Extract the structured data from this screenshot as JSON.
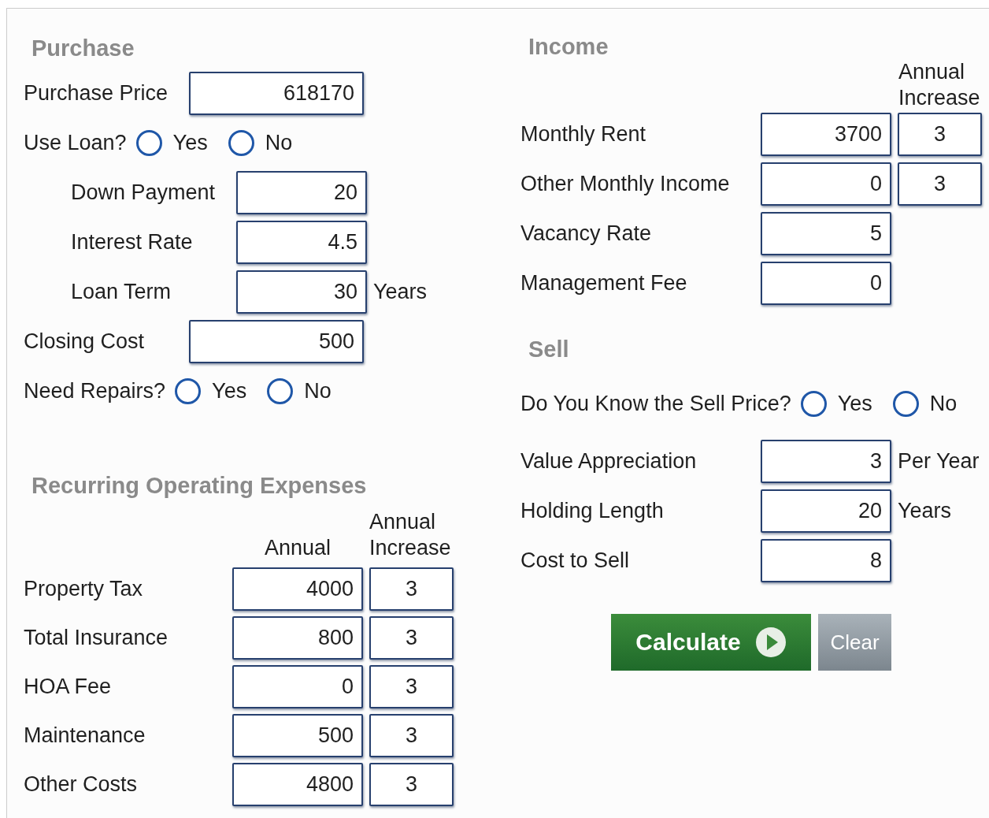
{
  "purchase": {
    "title": "Purchase",
    "items": [
      {
        "kind": "input",
        "label": "Purchase Price",
        "value": "618170"
      },
      {
        "kind": "radio",
        "label": "Use Loan?",
        "options": [
          {
            "label": "Yes",
            "selected": false
          },
          {
            "label": "No",
            "selected": false
          }
        ],
        "children": [
          {
            "kind": "input",
            "label": "Down Payment",
            "value": "20"
          },
          {
            "kind": "input",
            "label": "Interest Rate",
            "value": "4.5"
          },
          {
            "kind": "input",
            "label": "Loan Term",
            "value": "30",
            "unit": "Years"
          }
        ]
      },
      {
        "kind": "input",
        "label": "Closing Cost",
        "value": "500"
      },
      {
        "kind": "radio",
        "label": "Need Repairs?",
        "options": [
          {
            "label": "Yes",
            "selected": false
          },
          {
            "label": "No",
            "selected": false
          }
        ]
      }
    ]
  },
  "expenses": {
    "title": "Recurring Operating Expenses",
    "columns": [
      "Annual",
      "Annual Increase"
    ],
    "rows": [
      {
        "label": "Property Tax",
        "annual": "4000",
        "increase": "3"
      },
      {
        "label": "Total Insurance",
        "annual": "800",
        "increase": "3"
      },
      {
        "label": "HOA Fee",
        "annual": "0",
        "increase": "3"
      },
      {
        "label": "Maintenance",
        "annual": "500",
        "increase": "3"
      },
      {
        "label": "Other Costs",
        "annual": "4800",
        "increase": "3"
      }
    ]
  },
  "income": {
    "title": "Income",
    "increase_heading": "Annual Increase",
    "rows": [
      {
        "label": "Monthly Rent",
        "value": "3700",
        "increase": "3"
      },
      {
        "label": "Other Monthly Income",
        "value": "0",
        "increase": "3"
      },
      {
        "label": "Vacancy Rate",
        "value": "5"
      },
      {
        "label": "Management Fee",
        "value": "0"
      }
    ]
  },
  "sell": {
    "title": "Sell",
    "question": {
      "label": "Do You Know the Sell Price?",
      "options": [
        {
          "label": "Yes",
          "selected": false
        },
        {
          "label": "No",
          "selected": false
        }
      ]
    },
    "rows": [
      {
        "label": "Value Appreciation",
        "value": "3",
        "unit": "Per Year"
      },
      {
        "label": "Holding Length",
        "value": "20",
        "unit": "Years"
      },
      {
        "label": "Cost to Sell",
        "value": "8"
      }
    ]
  },
  "buttons": [
    {
      "label": "Calculate",
      "kind": "primary"
    },
    {
      "label": "Clear",
      "kind": "secondary"
    }
  ]
}
